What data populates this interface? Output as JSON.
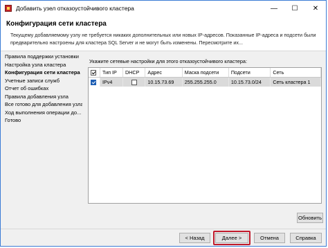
{
  "window": {
    "title": "Добавить узел отказоустойчивого кластера",
    "minimize": "—",
    "maximize": "☐",
    "close": "✕"
  },
  "header": {
    "title": "Конфигурация сети кластера",
    "description": "Текущему добавляемому узлу не требуется никаких дополнительных или новых IP-адресов. Показанные IP-адреса и подсети были предварительно настроены для кластера SQL Server и не могут быть изменены. Пересмотрите их..."
  },
  "nav": {
    "items": [
      {
        "label": "Правила поддержки установки",
        "active": false
      },
      {
        "label": "Настройка узла кластера",
        "active": false
      },
      {
        "label": "Конфигурация сети кластера",
        "active": true
      },
      {
        "label": "Учетные записи служб",
        "active": false
      },
      {
        "label": "Отчет об ошибках",
        "active": false
      },
      {
        "label": "Правила добавления узла",
        "active": false
      },
      {
        "label": "Все готово для добавления узла",
        "active": false
      },
      {
        "label": "Ход выполнения операции до...",
        "active": false
      },
      {
        "label": "Готово",
        "active": false
      }
    ]
  },
  "content": {
    "prompt": "Укажите сетевые настройки для этого отказоустойчивого кластера:",
    "columns": [
      "",
      "Тип IP",
      "DHCP",
      "Адрес",
      "Маска подсети",
      "Подсети",
      "Сеть"
    ],
    "rows": [
      {
        "selected": true,
        "ip_type": "IPv4",
        "dhcp": false,
        "address": "10.15.73.69",
        "mask": "255.255.255.0",
        "subnet": "10.15.73.0/24",
        "network": "Сеть кластера 1"
      }
    ],
    "refresh_label": "Обновить"
  },
  "footer": {
    "back_label": "< Назад",
    "next_label": "Далее >",
    "cancel_label": "Отмена",
    "help_label": "Справка"
  },
  "colors": {
    "highlight": "#c0192a",
    "checkbox_accent": "#1e5fb4",
    "selected_row": "#dadada"
  }
}
